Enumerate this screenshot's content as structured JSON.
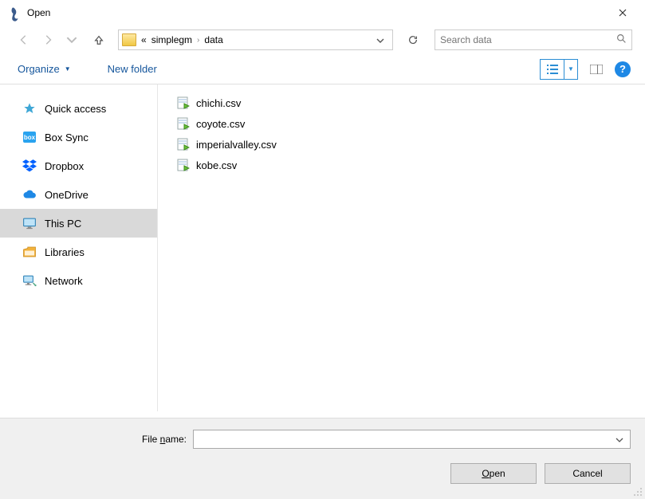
{
  "title": "Open",
  "breadcrumb": {
    "prefix": "«",
    "items": [
      "simplegm",
      "data"
    ]
  },
  "search": {
    "placeholder": "Search data"
  },
  "toolbar": {
    "organize_label": "Organize",
    "newfolder_label": "New folder"
  },
  "sidebar": {
    "items": [
      {
        "label": "Quick access",
        "icon": "star"
      },
      {
        "label": "Box Sync",
        "icon": "box"
      },
      {
        "label": "Dropbox",
        "icon": "dropbox"
      },
      {
        "label": "OneDrive",
        "icon": "cloud"
      },
      {
        "label": "This PC",
        "icon": "monitor",
        "selected": true
      },
      {
        "label": "Libraries",
        "icon": "library"
      },
      {
        "label": "Network",
        "icon": "network"
      }
    ]
  },
  "files": [
    {
      "name": "chichi.csv"
    },
    {
      "name": "coyote.csv"
    },
    {
      "name": "imperialvalley.csv"
    },
    {
      "name": "kobe.csv"
    }
  ],
  "bottom": {
    "filename_label": "File name:",
    "filename_value": "",
    "open_label": "Open",
    "cancel_label": "Cancel"
  }
}
